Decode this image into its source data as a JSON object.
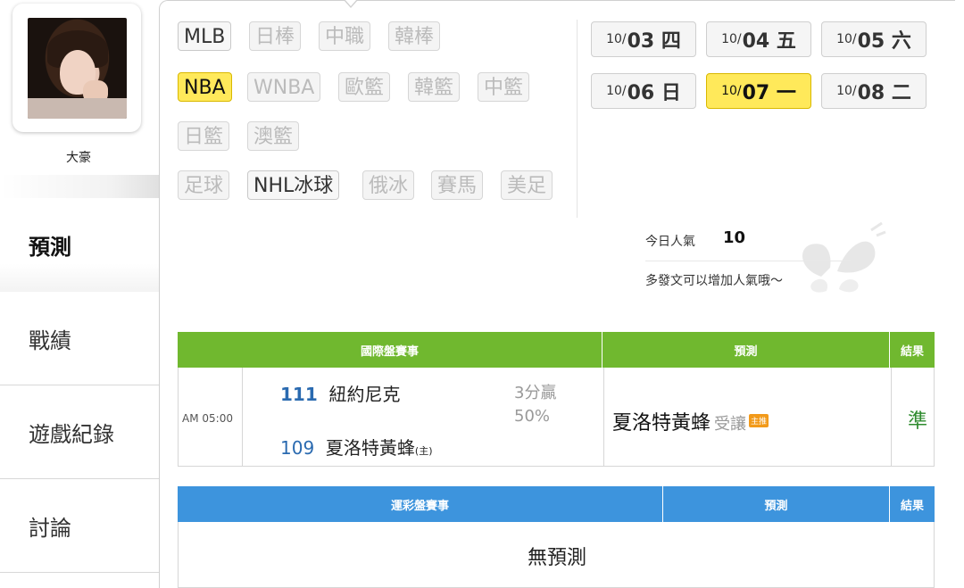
{
  "profile": {
    "name": "大豪"
  },
  "nav": [
    {
      "label": "預測"
    },
    {
      "label": "戰績"
    },
    {
      "label": "遊戲紀錄"
    },
    {
      "label": "討論"
    }
  ],
  "sports": {
    "row1": [
      "MLB",
      "日棒",
      "中職",
      "韓棒"
    ],
    "row2": [
      "NBA",
      "WNBA",
      "歐籃",
      "韓籃",
      "中籃"
    ],
    "row3": [
      "日籃",
      "澳籃"
    ],
    "row4": [
      "足球",
      "NHL冰球",
      "俄冰",
      "賽馬",
      "美足"
    ]
  },
  "dates": [
    {
      "md": "10/",
      "day": "03 四"
    },
    {
      "md": "10/",
      "day": "04 五"
    },
    {
      "md": "10/",
      "day": "05 六"
    },
    {
      "md": "10/",
      "day": "06 日"
    },
    {
      "md": "10/",
      "day": "07 一"
    },
    {
      "md": "10/",
      "day": "08 二"
    }
  ],
  "popularity": {
    "label": "今日人氣",
    "value": "10",
    "note": "多發文可以增加人氣哦～"
  },
  "intl_table": {
    "headers": [
      "國際盤賽事",
      "預測",
      "結果"
    ],
    "game": {
      "time": "AM 05:00",
      "away_no": "111",
      "away_team": "紐約尼克",
      "home_no": "109",
      "home_team": "夏洛特黃蜂",
      "home_mark": "(主)",
      "spread": "3分贏",
      "pct": "50%",
      "pick_team": "夏洛特黃蜂",
      "pick_side": "受讓",
      "pick_tag": "主推",
      "result": "準"
    }
  },
  "lottery_table": {
    "headers": [
      "運彩盤賽事",
      "預測",
      "結果"
    ],
    "empty": "無預測"
  },
  "colors": {
    "green_header": "#70b82f",
    "blue_header": "#3d94dd",
    "selected": "#ffe95a",
    "result_green": "#2e8b2e"
  }
}
